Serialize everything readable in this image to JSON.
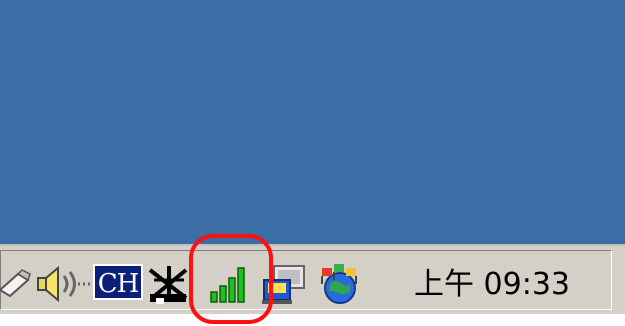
{
  "desktop": {
    "background_color": "#3a6ea5"
  },
  "tray": {
    "icons": [
      {
        "name": "partial-tray-icon"
      },
      {
        "name": "speaker-volume-icon"
      },
      {
        "name": "input-language-indicator",
        "label": "CH"
      },
      {
        "name": "disconnected-network-icon"
      },
      {
        "name": "signal-strength-icon",
        "highlighted": true
      },
      {
        "name": "network-connections-icon"
      },
      {
        "name": "globe-flags-icon"
      }
    ],
    "language_label": "CH",
    "clock": "上午 09:33"
  },
  "annotation": {
    "color": "#ff1010",
    "target": "signal-strength-icon"
  }
}
